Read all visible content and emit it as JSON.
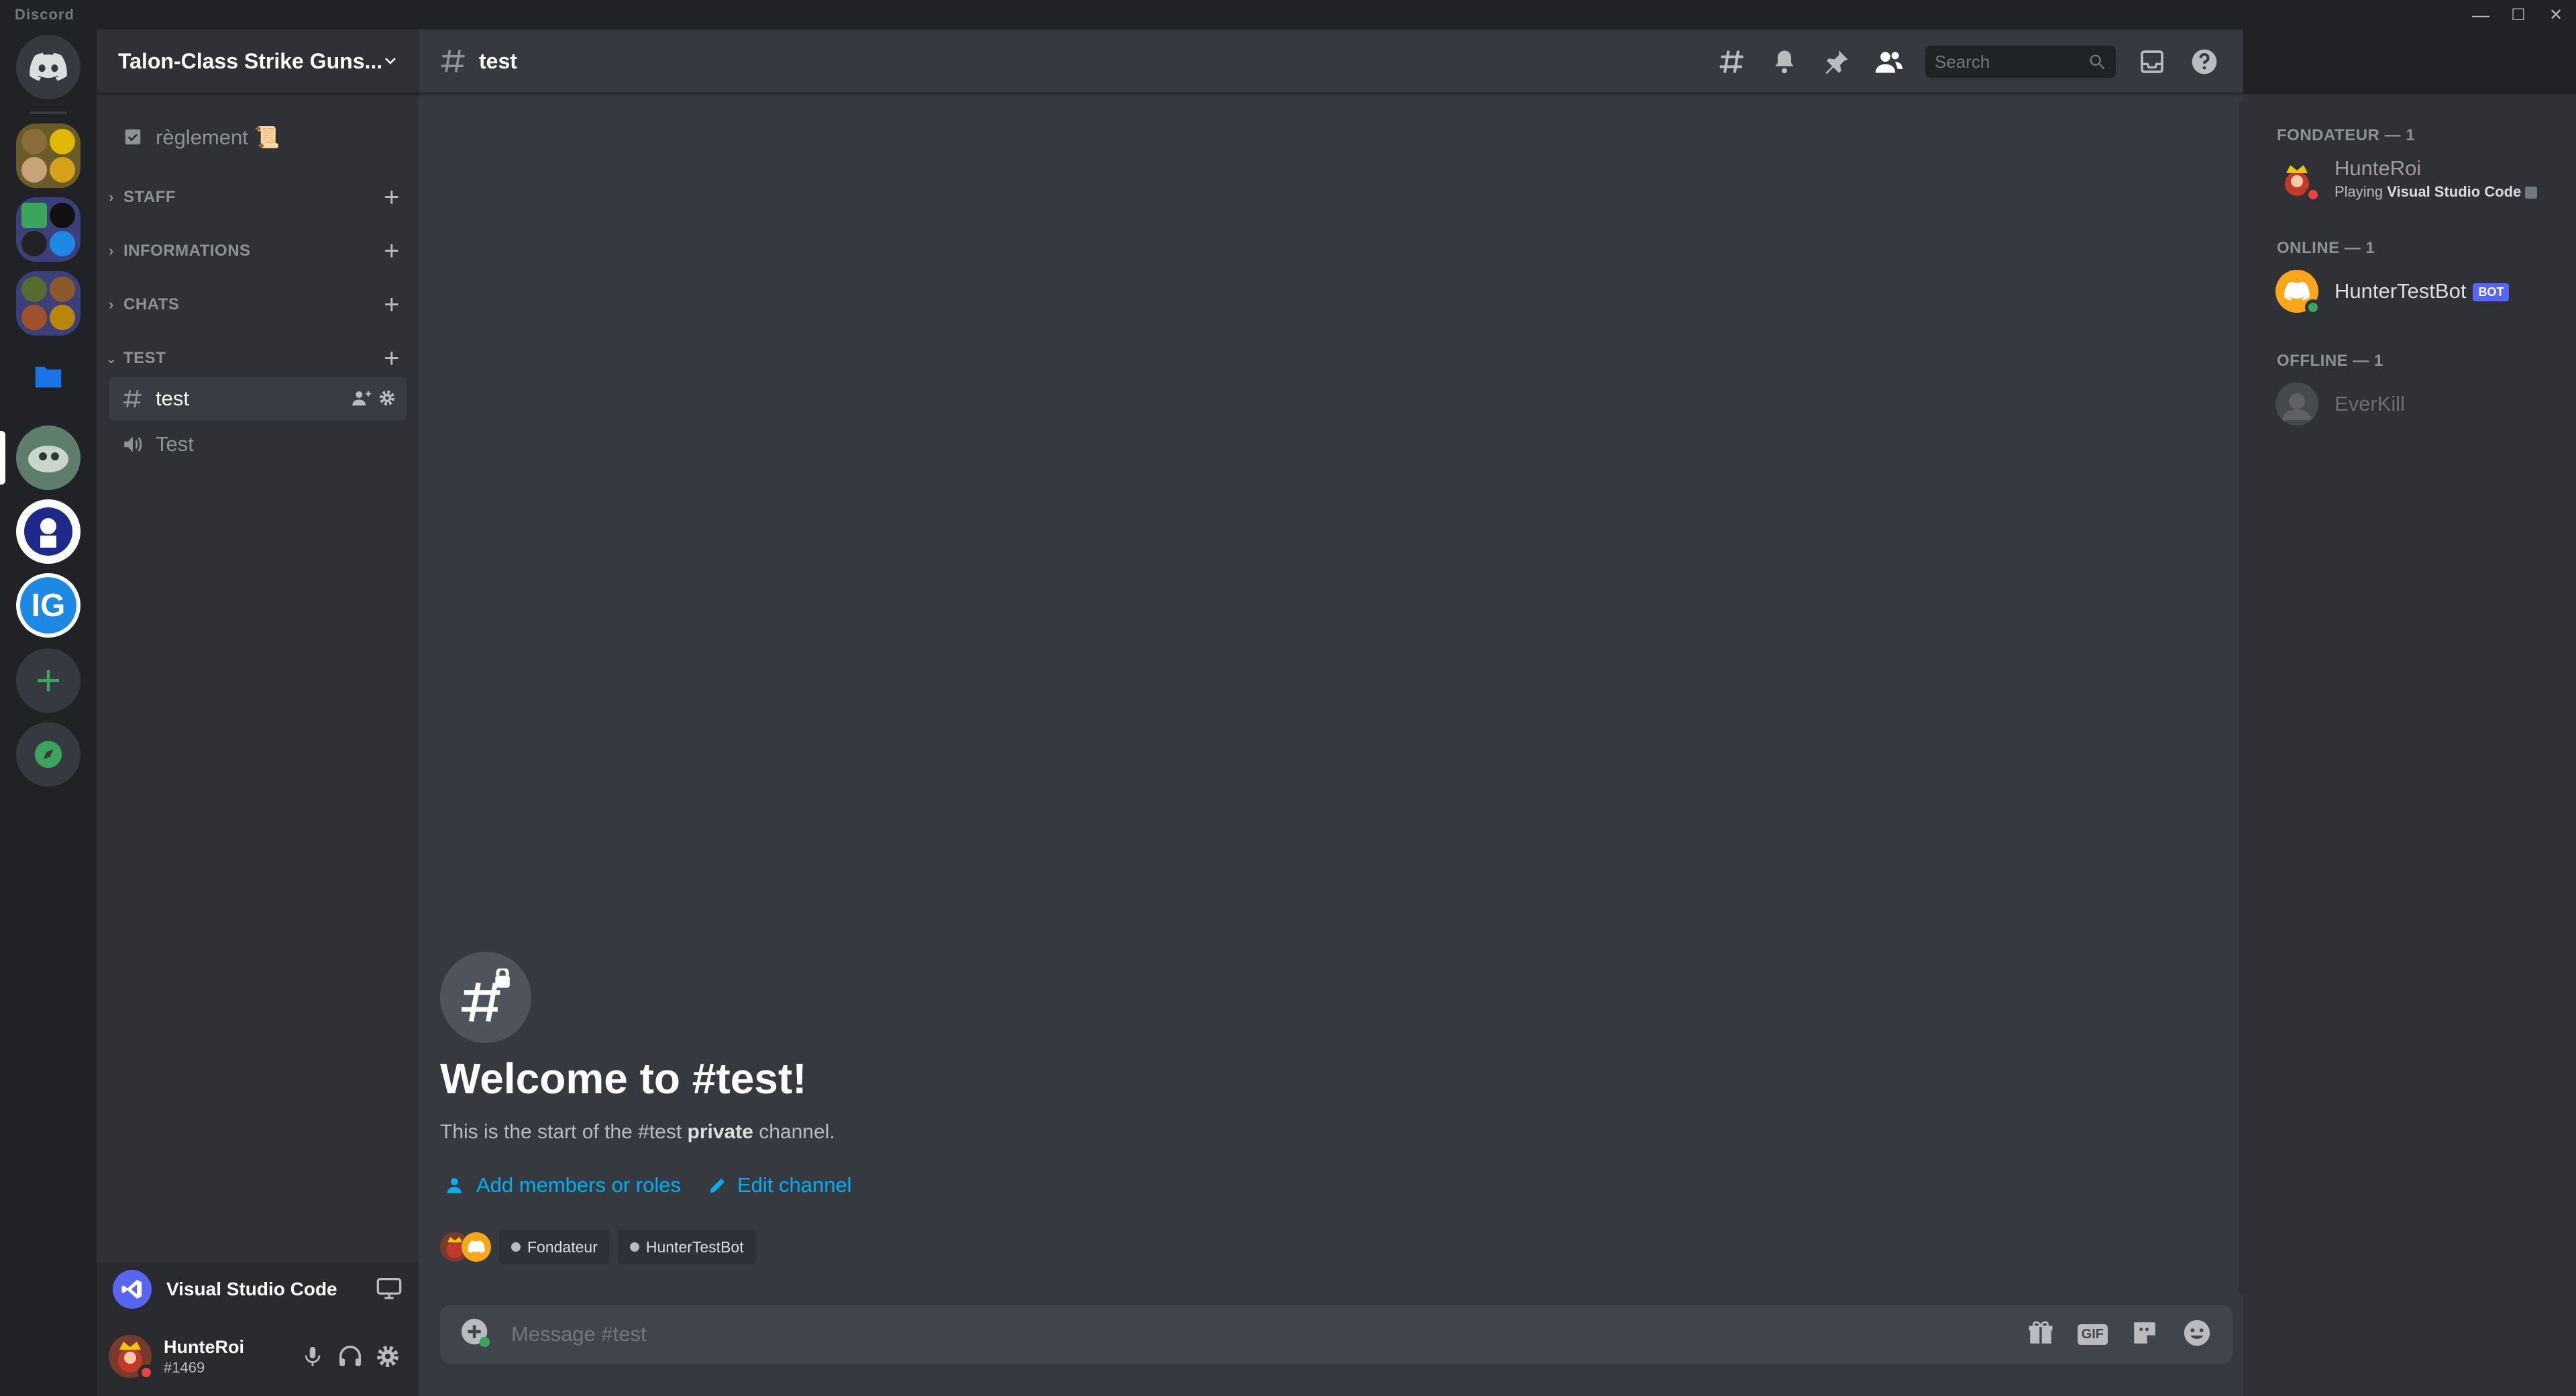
{
  "window": {
    "app_name": "Discord",
    "minimize": "—",
    "maximize": "☐",
    "close": "✕"
  },
  "colors": {
    "blurple": "#5865f2",
    "online": "#3ba55c",
    "dnd": "#ed4245",
    "link": "#00aff4"
  },
  "rail": {
    "servers": [
      "home",
      "folder-1",
      "folder-2",
      "folder-3",
      "folder-blue",
      "server-green",
      "server-white",
      "server-ig",
      "add-server",
      "explore"
    ],
    "ig_label": "IG"
  },
  "guild": {
    "name": "Talon-Class Strike Guns..."
  },
  "channels": {
    "top": {
      "name": "règlement 📜"
    },
    "categories": [
      {
        "name": "STAFF"
      },
      {
        "name": "INFORMATIONS"
      },
      {
        "name": "CHATS"
      },
      {
        "name": "TEST"
      }
    ],
    "test_text": {
      "name": "test"
    },
    "test_voice": {
      "name": "Test"
    }
  },
  "activity": {
    "label": "Visual Studio Code"
  },
  "user": {
    "name": "HunteRoi",
    "tag": "#1469"
  },
  "chat": {
    "channel_name": "test",
    "search_placeholder": "Search",
    "welcome_title": "Welcome to #test!",
    "welcome_sub_1": "This is the start of the #test ",
    "welcome_sub_bold": "private",
    "welcome_sub_2": " channel.",
    "add_members": "Add members or roles",
    "edit_channel": "Edit channel",
    "chips": [
      "Fondateur",
      "HunterTestBot"
    ],
    "composer_placeholder": "Message #test",
    "gif_label": "GIF"
  },
  "members": {
    "groups": [
      {
        "header": "FONDATEUR — 1"
      },
      {
        "header": "ONLINE — 1"
      },
      {
        "header": "OFFLINE — 1"
      }
    ],
    "fondateur": {
      "name": "HunteRoi",
      "activity_prefix": "Playing ",
      "activity_bold": "Visual Studio Code"
    },
    "online": {
      "name": "HunterTestBot",
      "badge": "BOT"
    },
    "offline": {
      "name": "EverKill"
    }
  }
}
